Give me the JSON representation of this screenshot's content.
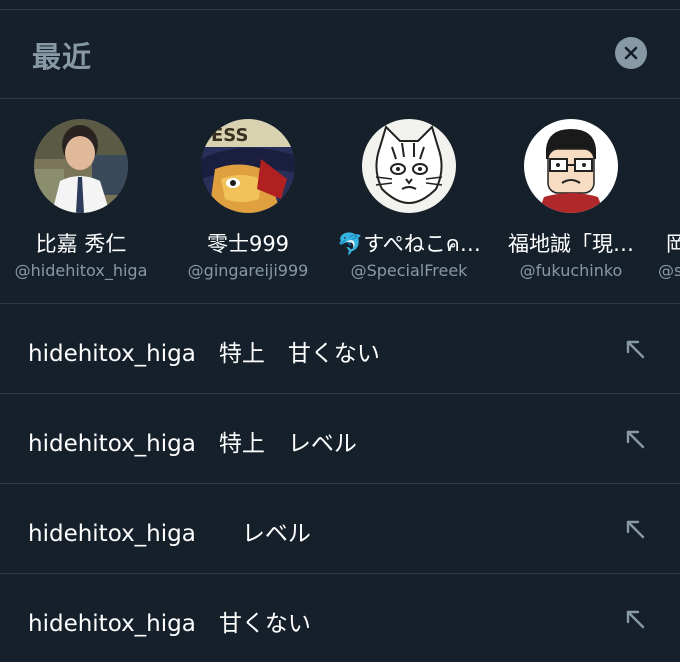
{
  "header": {
    "title": "最近",
    "close_icon": "close-circle-icon"
  },
  "recent_users": [
    {
      "name": "比嘉 秀仁",
      "handle": "@hidehitox_higa",
      "avatar": "photo-man-suit"
    },
    {
      "name": "零士999",
      "handle": "@gingareiji999",
      "avatar": "anime-character"
    },
    {
      "name": "🐬すぺねこค…",
      "handle": "@SpecialFreek",
      "avatar": "cat-sketch"
    },
    {
      "name": "福地誠「現…",
      "handle": "@fukuchinko",
      "avatar": "cartoon-man-glasses"
    },
    {
      "name": "岡",
      "handle": "@s",
      "avatar": ""
    }
  ],
  "recent_searches": [
    {
      "text": "hidehitox_higa　特上　甘くない",
      "icon": "arrow-up-left-icon"
    },
    {
      "text": "hidehitox_higa　特上　レベル",
      "icon": "arrow-up-left-icon"
    },
    {
      "text": "hidehitox_higa　　レベル",
      "icon": "arrow-up-left-icon"
    },
    {
      "text": "hidehitox_higa　甘くない",
      "icon": "arrow-up-left-icon"
    }
  ],
  "colors": {
    "background": "#15202b",
    "divider": "#2c3844",
    "secondary_text": "#8899a6",
    "primary_text": "#ffffff"
  }
}
